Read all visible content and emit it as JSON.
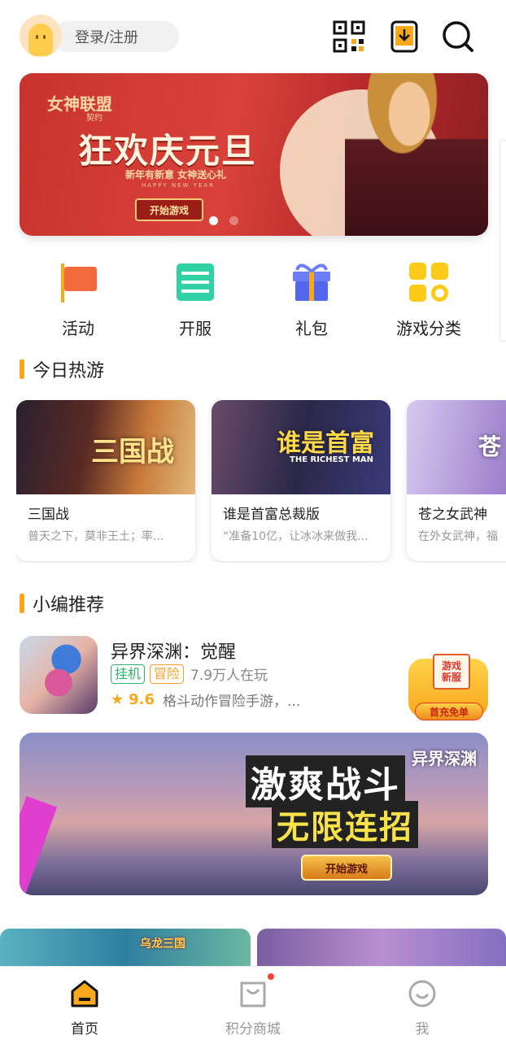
{
  "header": {
    "login_label": "登录/注册",
    "icons": [
      "qr-code-icon",
      "download-icon",
      "search-icon"
    ]
  },
  "banner": {
    "logo": "女神联盟",
    "sub_logo": "契约",
    "title": "狂欢庆元旦",
    "slogan": "新年有新意 女神送心礼",
    "slogan_en": "HAPPY NEW YEAR",
    "button": "开始游戏",
    "active_slide": 1,
    "slide_count": 2
  },
  "categories": [
    {
      "label": "活动",
      "icon": "flag-icon"
    },
    {
      "label": "开服",
      "icon": "server-icon"
    },
    {
      "label": "礼包",
      "icon": "gift-icon"
    },
    {
      "label": "游戏分类",
      "icon": "grid-icon"
    }
  ],
  "hot": {
    "title": "今日热游",
    "games": [
      {
        "thumb_title": "三国战",
        "name": "三国战",
        "desc": "普天之下，莫非王土；率..."
      },
      {
        "thumb_title": "谁是首富",
        "thumb_sub": "THE RICHEST MAN",
        "name": "谁是首富总裁版",
        "desc": "“准备10亿，让冰冰来做我..."
      },
      {
        "thumb_title": "苍",
        "name": "苍之女武神",
        "desc": "在外女武神，福"
      }
    ]
  },
  "recommend": {
    "title": "小编推荐",
    "game": {
      "name": "异界深渊：觉醒",
      "tags": [
        "挂机",
        "冒险"
      ],
      "players": "7.9万人在玩",
      "score": "9.6",
      "desc": "格斗动作冒险手游，..."
    },
    "promo": {
      "line1": "游戏",
      "line2": "新服",
      "ribbon": "首充免单"
    },
    "banner": {
      "logo": "异界深渊",
      "line1": "激爽战斗",
      "line2": "无限连招",
      "button": "开始游戏"
    },
    "more_logo": "乌龙三国"
  },
  "nav": [
    {
      "label": "首页",
      "icon": "home-icon",
      "active": true
    },
    {
      "label": "积分商城",
      "icon": "shopping-bag-icon",
      "badge": true
    },
    {
      "label": "我",
      "icon": "profile-icon"
    }
  ],
  "colors": {
    "accent": "#f7a81b",
    "tag_green": "#2fb36a",
    "tag_orange": "#f2a22b",
    "badge_red": "#f44336"
  }
}
